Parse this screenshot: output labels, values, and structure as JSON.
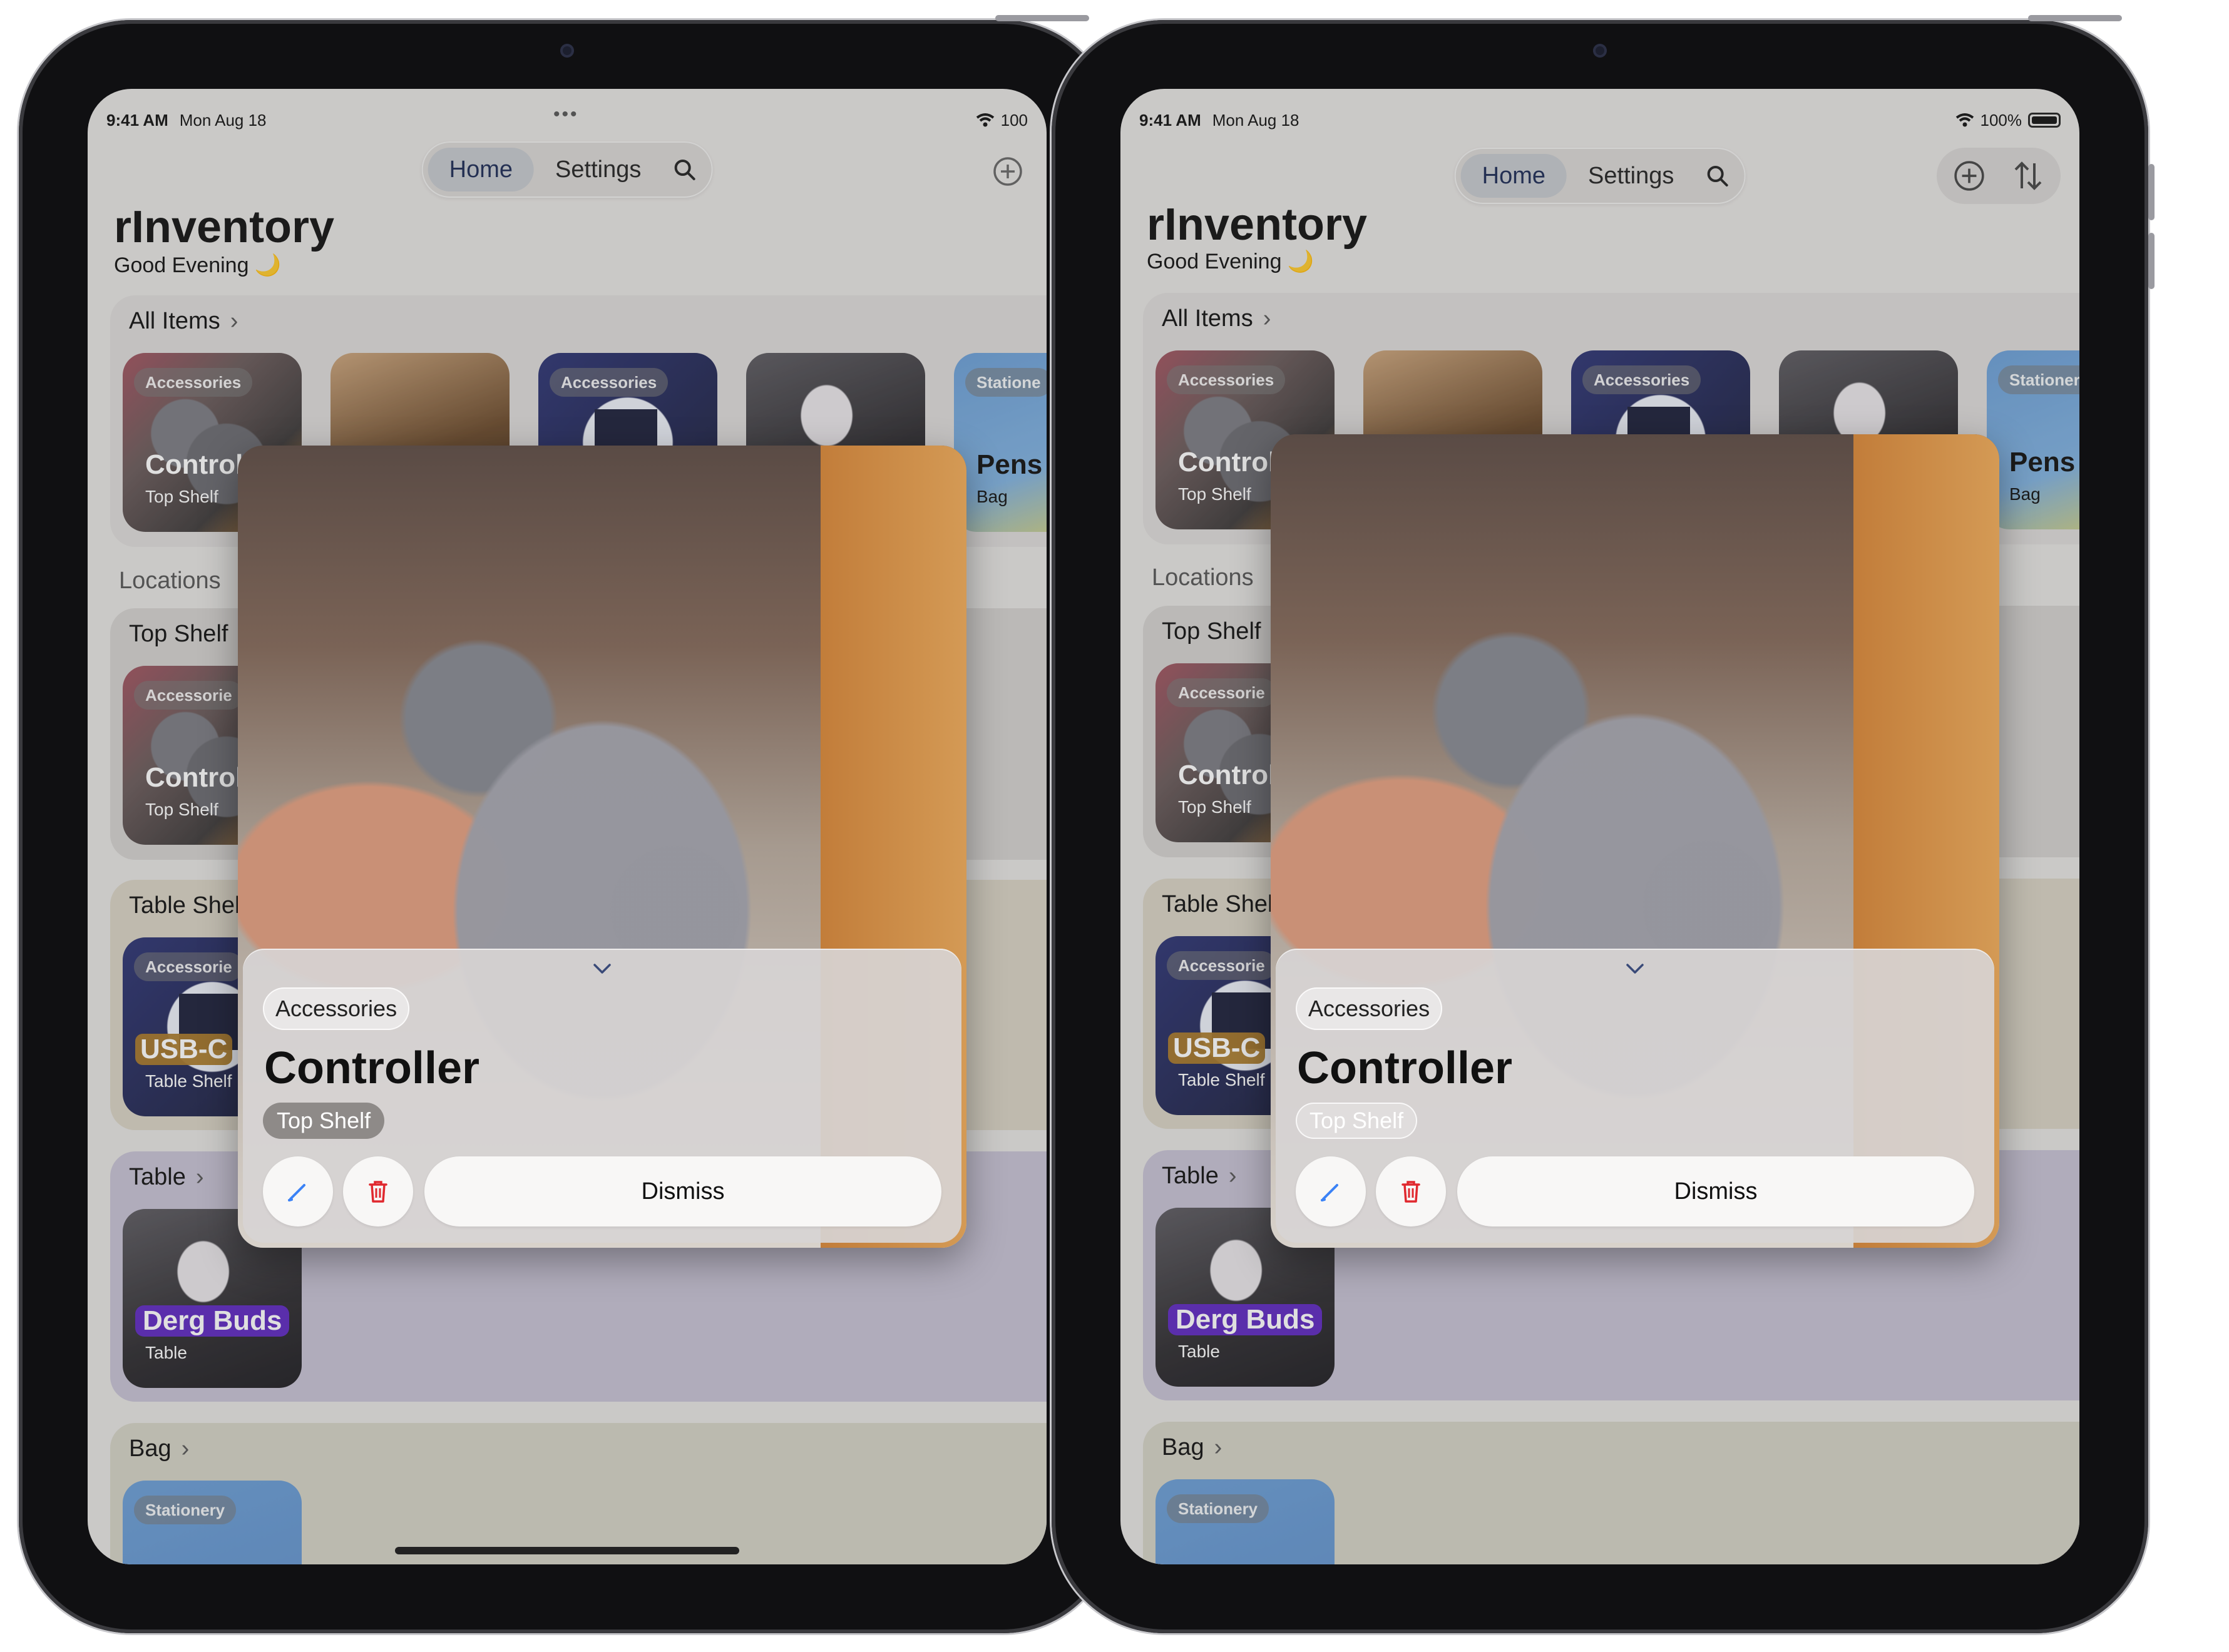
{
  "status": {
    "time": "9:41 AM",
    "date": "Mon Aug 18",
    "battery_left": "100",
    "battery_right": "100%"
  },
  "nav": {
    "tabs": [
      "Home",
      "Settings"
    ],
    "active_tab": "Home"
  },
  "app": {
    "title": "rInventory",
    "greeting": "Good Evening 🌙"
  },
  "sections": {
    "all_items": "All Items",
    "locations": "Locations",
    "top_shelf": "Top Shelf",
    "table_shelf": "Table Shelf",
    "table": "Table",
    "bag": "Bag"
  },
  "cards": {
    "controller": {
      "category": "Accessories",
      "name": "Controller",
      "location": "Top Shelf"
    },
    "usbc": {
      "category": "Accessories",
      "name": "USB-C",
      "location": "Table Shelf"
    },
    "derg": {
      "name": "Derg Buds",
      "location": "Table"
    },
    "pens": {
      "category": "Stationery",
      "name": "Pens & P...",
      "location": "Bag"
    },
    "stationery": {
      "category": "Stationery"
    }
  },
  "left_truncated": {
    "controller_name": "Control",
    "usbc_name": "USB-C",
    "accessories_short": "Accessorie",
    "stationery_short": "Statione",
    "pens_short": "Pens",
    "table_shelf_short": "Table Shel"
  },
  "right_truncated": {
    "controller_name": "Control",
    "usbc_name": "USB-C",
    "accessories_short": "Accessorie",
    "table_shelf_short": "Table Shel"
  },
  "detail": {
    "category": "Accessories",
    "title": "Controller",
    "location": "Top Shelf",
    "dismiss_label": "Dismiss"
  },
  "colors": {
    "tint_top_shelf": "#c9c7c5",
    "tint_table_shelf": "#d4cfc2",
    "tint_table": "#c4bfd2",
    "tint_bag": "#d1cfc2",
    "accent": "#1b2a55",
    "delete": "#e0282e",
    "edit": "#3b82f6"
  },
  "icons": [
    "search-icon",
    "plus-circle-icon",
    "sort-arrows-icon",
    "chevron-right-icon",
    "chevron-down-icon",
    "pencil-icon",
    "trash-icon",
    "wifi-icon",
    "battery-icon",
    "moon-icon"
  ]
}
